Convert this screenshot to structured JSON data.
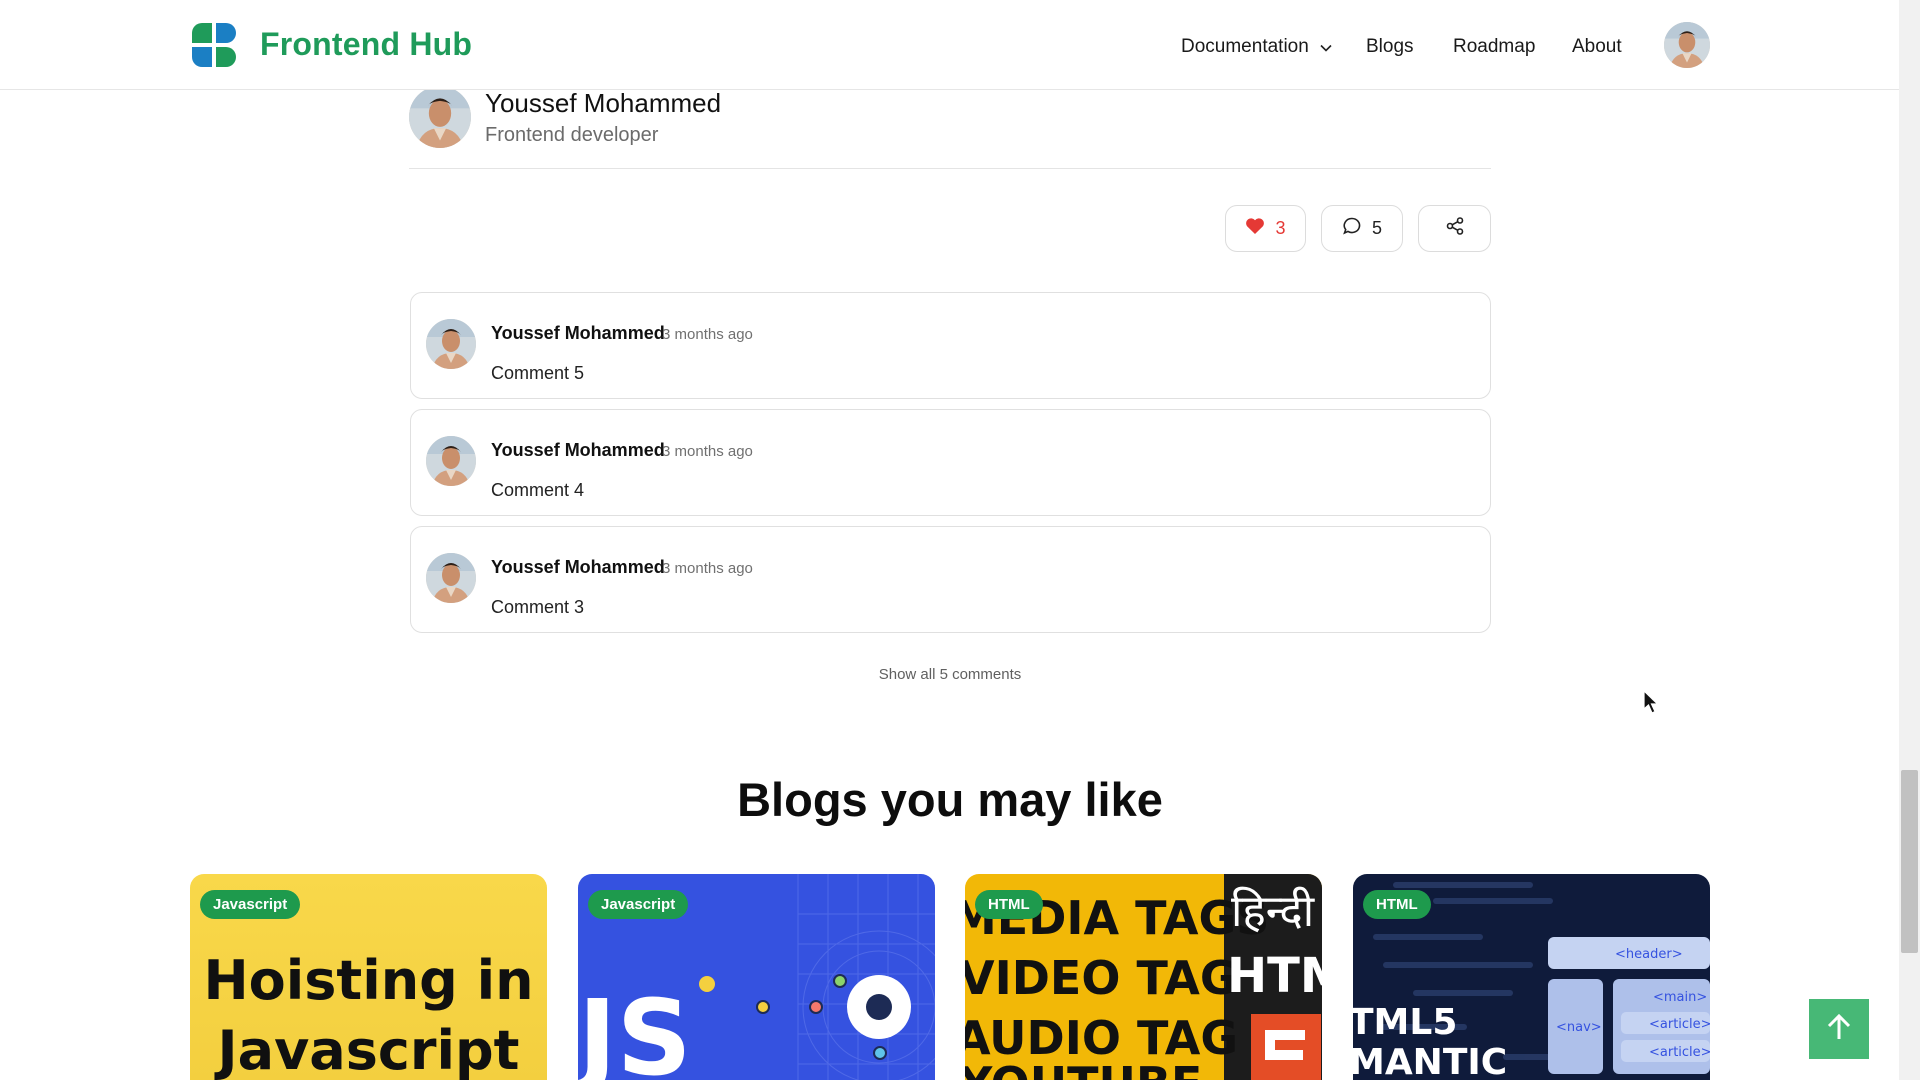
{
  "header": {
    "brand": "Frontend Hub",
    "nav": {
      "documentation": "Documentation",
      "blogs": "Blogs",
      "roadmap": "Roadmap",
      "about": "About"
    }
  },
  "author": {
    "name": "Youssef Mohammed",
    "role": "Frontend developer"
  },
  "actions": {
    "likes": "3",
    "comments": "5"
  },
  "comments": [
    {
      "author": "Youssef Mohammed",
      "time": "3 months ago",
      "text": "Comment 5"
    },
    {
      "author": "Youssef Mohammed",
      "time": "3 months ago",
      "text": "Comment 4"
    },
    {
      "author": "Youssef Mohammed",
      "time": "3 months ago",
      "text": "Comment 3"
    }
  ],
  "show_all": "Show all 5 comments",
  "related": {
    "title": "Blogs you may like",
    "cards": [
      {
        "tag": "Javascript",
        "title_line1": "Hoisting in",
        "title_line2": "Javascript"
      },
      {
        "tag": "Javascript",
        "title": "JS"
      },
      {
        "tag": "HTML",
        "lines": [
          "MEDIA TAGS",
          "VIDEO TAG",
          "AUDIO TAG",
          "YOUTUBE"
        ],
        "side_text": "हिन्दी",
        "side_label": "HTM"
      },
      {
        "tag": "HTML",
        "lines": [
          "TML5",
          "MANTIC"
        ],
        "code_tags": [
          "<header>",
          "<nav>",
          "<main>",
          "<article>",
          "<article>"
        ]
      }
    ]
  },
  "colors": {
    "brand_green": "#1f9b5a",
    "brand_blue": "#1b7fc4",
    "tag_green": "#1e9a4d",
    "like_red": "#e53935",
    "back_to_top": "#47b876"
  },
  "icons": [
    "logo-icon",
    "chevron-down-icon",
    "heart-icon",
    "comment-icon",
    "share-icon",
    "arrow-up-icon",
    "cursor-icon"
  ]
}
